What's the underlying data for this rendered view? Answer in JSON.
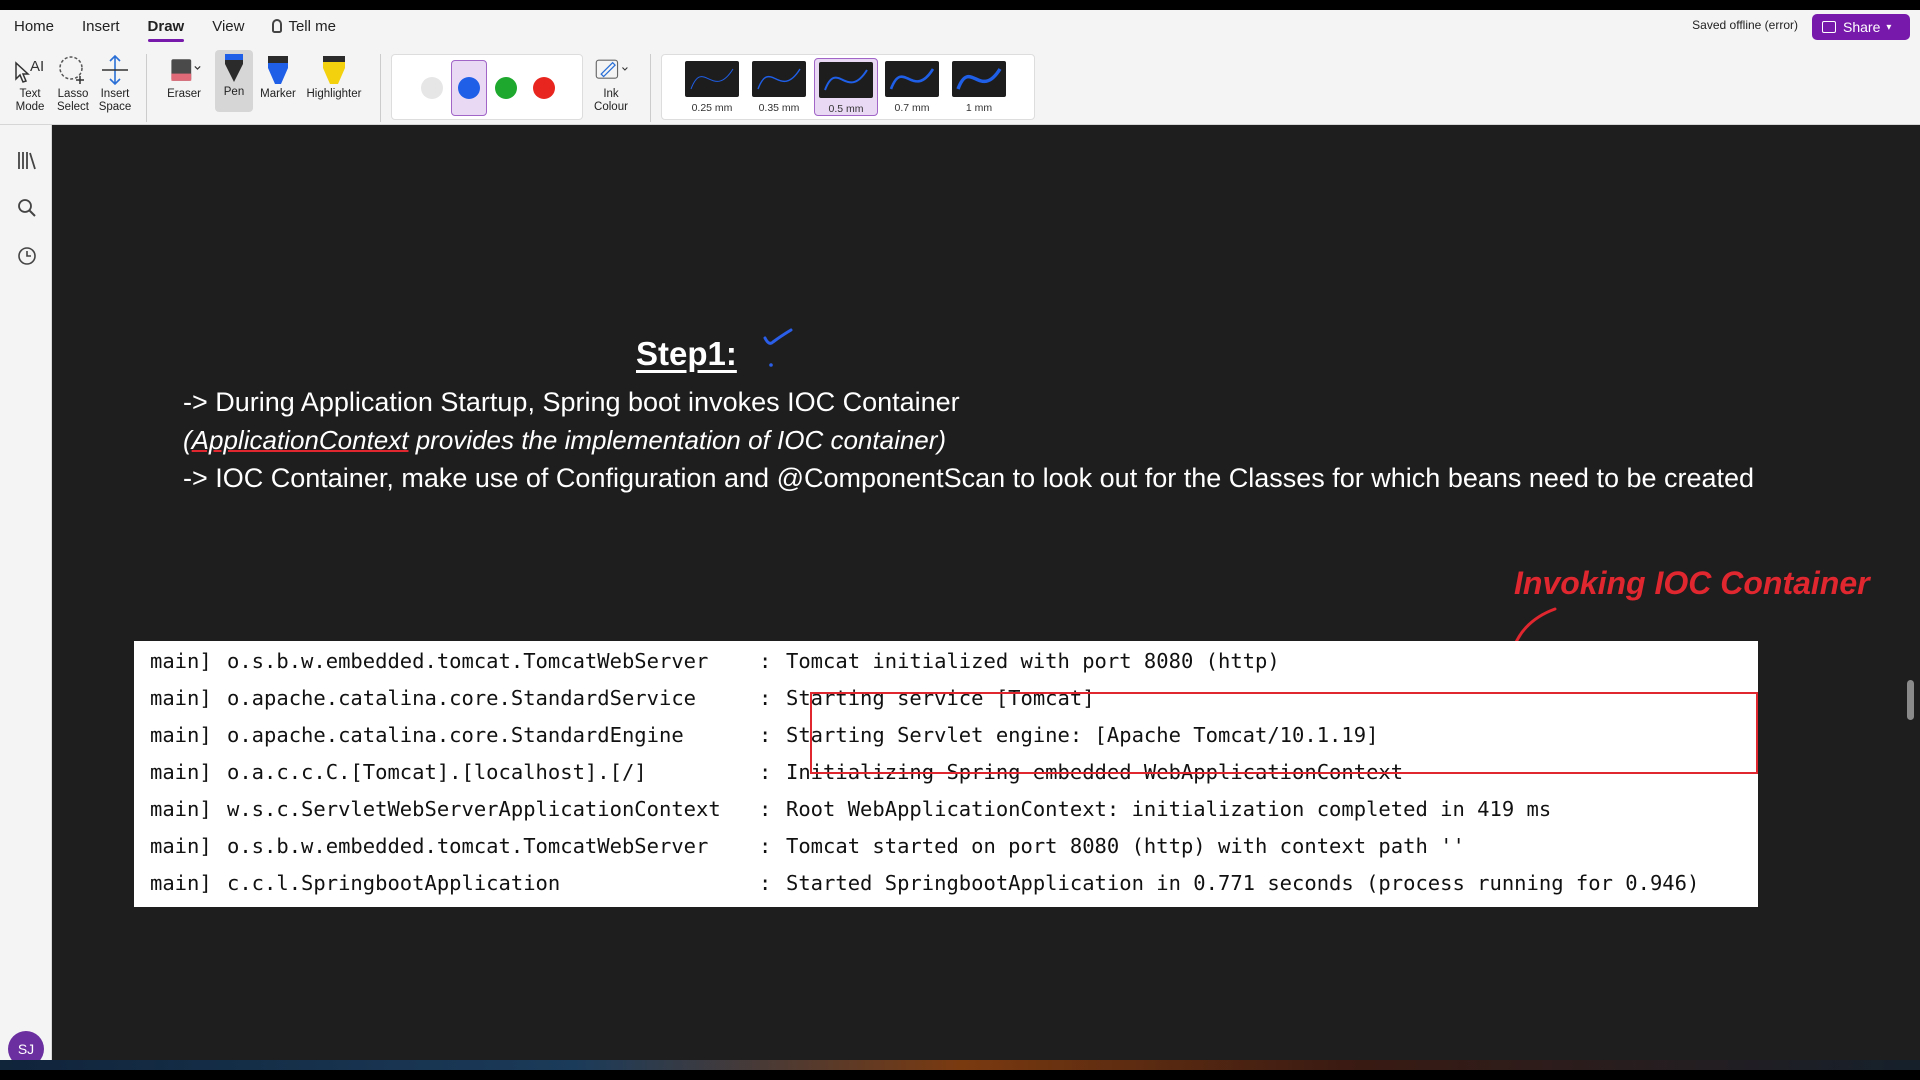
{
  "menu": {
    "items": [
      "Home",
      "Insert",
      "Draw",
      "View"
    ],
    "tell_me": "Tell me"
  },
  "status": {
    "saved": "Saved offline (error)"
  },
  "share": {
    "label": "Share"
  },
  "tools": {
    "text_mode": [
      "Text",
      "Mode"
    ],
    "lasso_select": [
      "Lasso",
      "Select"
    ],
    "insert_space": [
      "Insert",
      "Space"
    ],
    "eraser": "Eraser",
    "pen": "Pen",
    "marker": "Marker",
    "highlighter": "Highlighter",
    "ink_colour": [
      "Ink",
      "Colour"
    ]
  },
  "colors": {
    "swatches": [
      "#e6e6e6",
      "#1f5fe8",
      "#1ea82e",
      "#e8261f"
    ],
    "selected_index": 1,
    "accent": "#7719aa",
    "annotation_red": "#e0262f"
  },
  "pen_widths": [
    "0.25 mm",
    "0.35 mm",
    "0.5 mm",
    "0.7 mm",
    "1 mm"
  ],
  "pen_width_selected_index": 2,
  "user": {
    "initials": "SJ"
  },
  "note": {
    "step_title": "Step1:",
    "line1": "-> During Application Startup, Spring boot invokes IOC Container",
    "line2_open": "(",
    "line2_underlined": "ApplicationContext",
    "line2_rest": " provides the implementation of IOC container)",
    "line3": "-> IOC Container, make use of Configuration and @ComponentScan to look out for the Classes for which beans need to be created",
    "annotation": "Invoking IOC Container"
  },
  "log": {
    "rows": [
      {
        "thread": "main]",
        "logger": "o.s.b.w.embedded.tomcat.TomcatWebServer",
        "colon": ":",
        "message": "Tomcat initialized with port 8080 (http)"
      },
      {
        "thread": "main]",
        "logger": "o.apache.catalina.core.StandardService",
        "colon": ":",
        "message": "Starting service [Tomcat]"
      },
      {
        "thread": "main]",
        "logger": "o.apache.catalina.core.StandardEngine",
        "colon": ":",
        "message": "Starting Servlet engine: [Apache Tomcat/10.1.19]"
      },
      {
        "thread": "main]",
        "logger": "o.a.c.c.C.[Tomcat].[localhost].[/]",
        "colon": ":",
        "message": "Initializing Spring embedded WebApplicationContext"
      },
      {
        "thread": "main]",
        "logger": "w.s.c.ServletWebServerApplicationContext",
        "colon": ":",
        "message": "Root WebApplicationContext: initialization completed in 419 ms"
      },
      {
        "thread": "main]",
        "logger": "o.s.b.w.embedded.tomcat.TomcatWebServer",
        "colon": ":",
        "message": "Tomcat started on port 8080 (http) with context path ''"
      },
      {
        "thread": "main]",
        "logger": "c.c.l.SpringbootApplication",
        "colon": ":",
        "message": "Started SpringbootApplication in 0.771 seconds (process running for 0.946)"
      }
    ]
  }
}
